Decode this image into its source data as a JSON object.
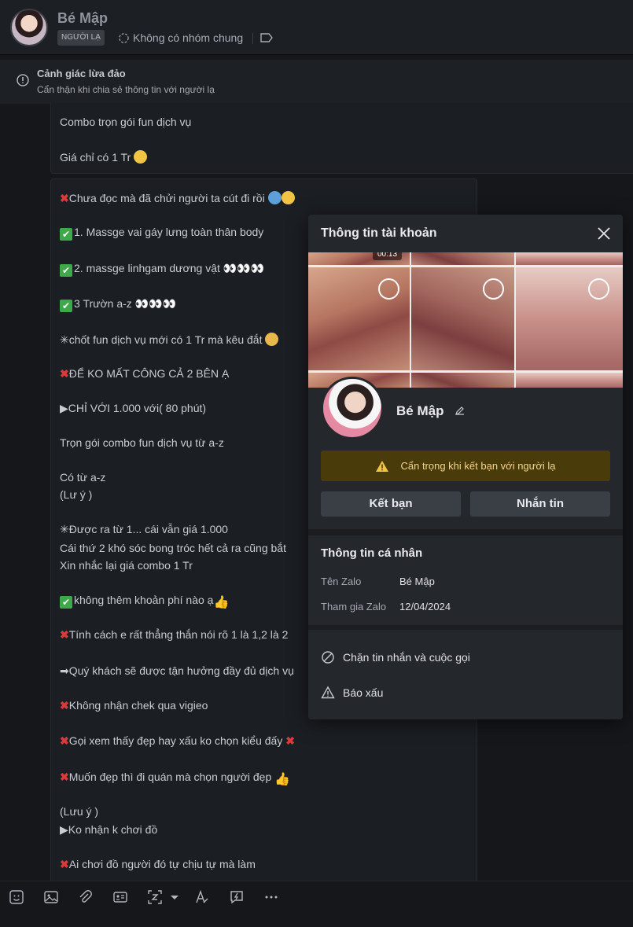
{
  "header": {
    "name": "Bé Mập",
    "badge": "NGƯỜI LẠ",
    "common_groups": "Không có nhóm chung"
  },
  "warning": {
    "title": "Cảnh giác lừa đảo",
    "subtitle": "Cẩn thận khi chia sẻ thông tin với người lạ"
  },
  "message1": {
    "line1": "Combo trọn gói fun dịch vụ",
    "line2": "Giá chỉ có 1 Tr"
  },
  "message2": {
    "lines": [
      "Chưa đọc mà đã chửi người ta cút đi rồi",
      "1. Massge  vai gáy lưng toàn thân body",
      "2. massge linhgam dương vật",
      "3 Trườn a-z",
      "✳chốt fun dịch vụ mới có 1 Tr mà kêu đắt",
      "ĐỂ KO MẤT CÔNG CẢ 2 BÊN Ạ",
      "▶CHỈ VỚI 1.000 với( 80 phút)",
      "Trọn gói combo fun dịch vụ từ a-z",
      "Có từ a-z",
      "(Lư ý )",
      "✳Được ra từ 1... cái vẫn giá 1.000",
      "Cái thứ 2 khó sóc bong tróc hết cả ra cũng bắt",
      "Xin nhắc lại giá combo 1 Tr",
      "không thêm khoản phí nào ạ",
      "Tính cách e rất thẳng thắn nói rõ 1 là 1,2 là 2",
      "➡Quý khách sẽ được tận hưởng đầy đủ dịch vụ",
      "Không nhận chek qua vigieo",
      "Gọi xem thấy đẹp hay xấu ko chọn kiểu đấy",
      "Muốn đẹp thì đi quán mà chọn người đẹp",
      "(Lưu ý )",
      "▶Ko nhận k chơi đồ",
      "Ai chơi đồ người đó tự chịu tự mà làm"
    ]
  },
  "panel": {
    "title": "Thông tin tài khoản",
    "video_time": "00:13",
    "name": "Bé Mập",
    "caution": "Cẩn trọng khi kết bạn với người lạ",
    "add_friend": "Kết bạn",
    "send_message": "Nhắn tin",
    "personal_title": "Thông tin cá nhân",
    "zalo_name_label": "Tên Zalo",
    "zalo_name_value": "Bé Mập",
    "joined_label": "Tham gia Zalo",
    "joined_value": "12/04/2024",
    "block": "Chặn tin nhắn và cuộc gọi",
    "report": "Báo xấu"
  },
  "colors": {
    "accent_warning_bg": "#4a3b0b",
    "accent_warning_text": "#f3d58b",
    "red_x": "#d93a3a",
    "green_check": "#3da94a"
  },
  "icons": [
    "sticker-icon",
    "image-icon",
    "attachment-icon",
    "contact-card-icon",
    "screenshot-icon",
    "text-format-icon",
    "quick-message-icon",
    "more-icon"
  ]
}
